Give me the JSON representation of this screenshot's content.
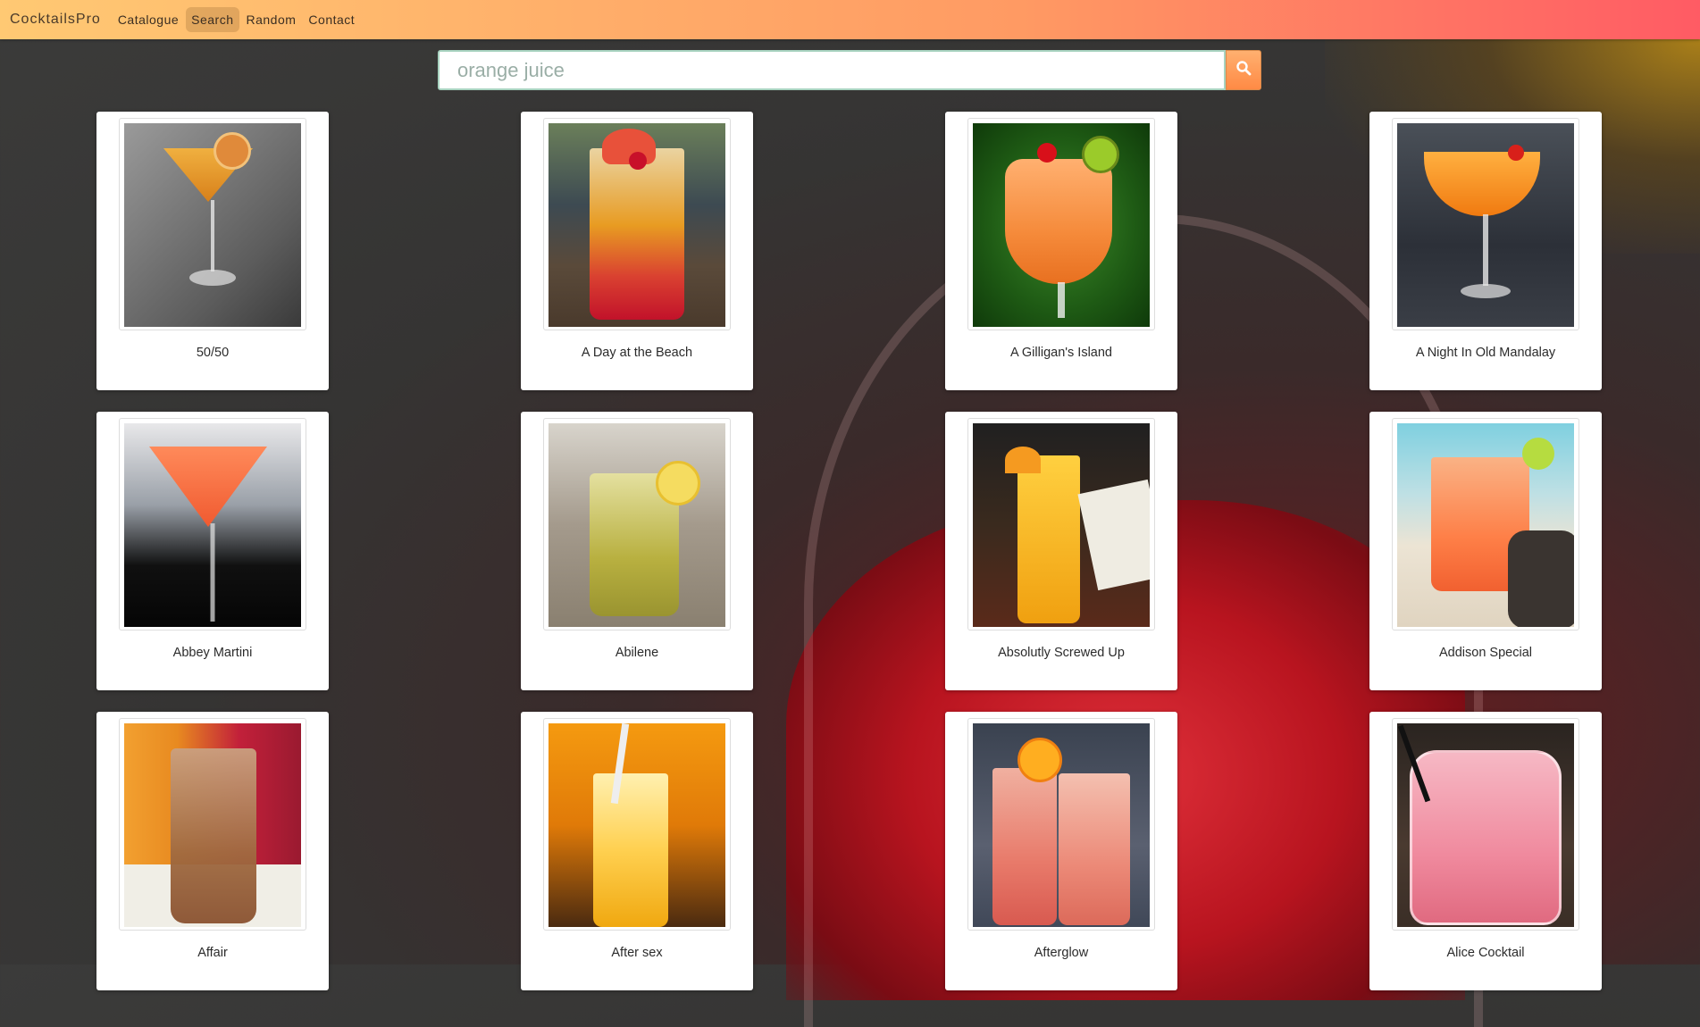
{
  "nav": {
    "brand": "CocktailsPro",
    "links": [
      {
        "label": "Catalogue",
        "active": false
      },
      {
        "label": "Search",
        "active": true
      },
      {
        "label": "Random",
        "active": false
      },
      {
        "label": "Contact",
        "active": false
      }
    ]
  },
  "search": {
    "value": "orange juice",
    "button_icon": "search-icon"
  },
  "colors": {
    "nav_gradient_start": "#ffc973",
    "nav_gradient_end": "#ff5b64",
    "search_button": "#ff8a45",
    "search_border": "#a8d3c0"
  },
  "cocktails": [
    {
      "name": "50/50"
    },
    {
      "name": "A Day at the Beach"
    },
    {
      "name": "A Gilligan's Island"
    },
    {
      "name": "A Night In Old Mandalay"
    },
    {
      "name": "Abbey Martini"
    },
    {
      "name": "Abilene"
    },
    {
      "name": "Absolutly Screwed Up"
    },
    {
      "name": "Addison Special"
    },
    {
      "name": "Affair"
    },
    {
      "name": "After sex"
    },
    {
      "name": "Afterglow"
    },
    {
      "name": "Alice Cocktail"
    }
  ]
}
